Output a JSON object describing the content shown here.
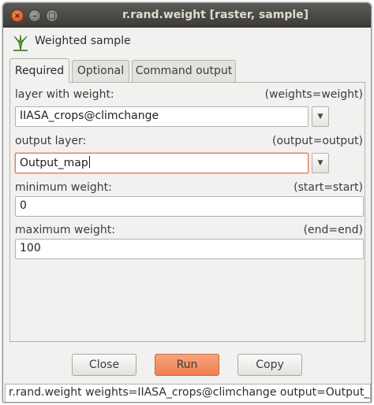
{
  "window": {
    "title": "r.rand.weight [raster, sample]",
    "close_glyph": "×",
    "minimize_glyph": "–",
    "maximize_glyph": "□"
  },
  "header": {
    "icon": "grass-module-icon",
    "text": "Weighted sample"
  },
  "tabs": [
    {
      "label": "Required",
      "active": true
    },
    {
      "label": "Optional",
      "active": false
    },
    {
      "label": "Command output",
      "active": false
    }
  ],
  "fields": {
    "layer_with_weight": {
      "label": "layer with weight:",
      "hint": "(weights=weight)",
      "value": "IIASA_crops@climchange"
    },
    "output_layer": {
      "label": "output layer:",
      "hint": "(output=output)",
      "value": "Output_map"
    },
    "minimum_weight": {
      "label": "minimum weight:",
      "hint": "(start=start)",
      "value": "0"
    },
    "maximum_weight": {
      "label": "maximum weight:",
      "hint": "(end=end)",
      "value": "100"
    }
  },
  "buttons": {
    "close": "Close",
    "run": "Run",
    "copy": "Copy"
  },
  "dropdown_glyph": "▼",
  "status_bar": "r.rand.weight weights=IIASA_crops@climchange output=Output_map",
  "colors": {
    "accent": "#ef7f4f",
    "titlebar": "#3d3c38",
    "window_bg": "#f2f1f0"
  }
}
